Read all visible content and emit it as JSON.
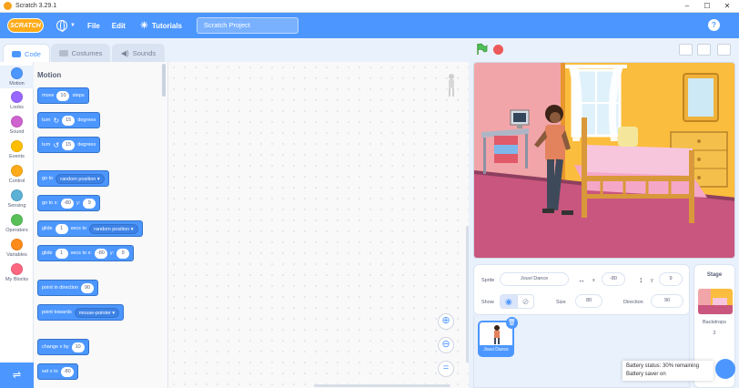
{
  "window": {
    "title": "Scratch 3.29.1",
    "controls": [
      "–",
      "☐",
      "✕"
    ]
  },
  "menubar": {
    "logo": "SCRATCH",
    "file": "File",
    "edit": "Edit",
    "tutorials": "Tutorials",
    "project_title": "Scratch Project"
  },
  "tabs": {
    "code": "Code",
    "costumes": "Costumes",
    "sounds": "Sounds"
  },
  "categories": [
    {
      "label": "Motion",
      "color": "#4c97ff"
    },
    {
      "label": "Looks",
      "color": "#9966ff"
    },
    {
      "label": "Sound",
      "color": "#cf63cf"
    },
    {
      "label": "Events",
      "color": "#ffbf00"
    },
    {
      "label": "Control",
      "color": "#ffab19"
    },
    {
      "label": "Sensing",
      "color": "#5cb1d6"
    },
    {
      "label": "Operators",
      "color": "#59c059"
    },
    {
      "label": "Variables",
      "color": "#ff8c1a"
    },
    {
      "label": "My Blocks",
      "color": "#ff6680"
    }
  ],
  "palette": {
    "section": "Motion",
    "move": {
      "a": "move",
      "n": "10",
      "b": "steps"
    },
    "turn_right": {
      "a": "turn",
      "n": "15",
      "b": "degrees"
    },
    "turn_left": {
      "a": "turn",
      "n": "15",
      "b": "degrees"
    },
    "goto": {
      "a": "go to",
      "dd": "random position"
    },
    "gotoxy": {
      "a": "go to x:",
      "x": "-80",
      "b": "y:",
      "y": "9"
    },
    "glide_to": {
      "a": "glide",
      "n": "1",
      "b": "secs to",
      "dd": "random position"
    },
    "glide_xy": {
      "a": "glide",
      "n": "1",
      "b": "secs to x:",
      "x": "-80",
      "c": "y:",
      "y": "9"
    },
    "point_dir": {
      "a": "point in direction",
      "n": "90"
    },
    "point_towards": {
      "a": "point towards",
      "dd": "mouse-pointer"
    },
    "change_x": {
      "a": "change x by",
      "n": "10"
    },
    "set_x": {
      "a": "set x to",
      "n": "-80"
    }
  },
  "sprite_info": {
    "sprite_label": "Sprite",
    "sprite_name": "Jouvi Dance",
    "x_label": "x",
    "x": "-80",
    "y_label": "y",
    "y": "9",
    "show_label": "Show",
    "size_label": "Size",
    "size": "80",
    "direction_label": "Direction",
    "direction": "90"
  },
  "sprite_tile": {
    "name": "Jouvi Dance"
  },
  "stage_pane": {
    "title": "Stage",
    "backdrops_label": "Backdrops",
    "backdrops_count": "2"
  },
  "toast": {
    "line1": "Battery status: 30% remaining",
    "line2": "Battery saver on"
  },
  "colors": {
    "accent": "#4c97ff",
    "green_flag": "#4cbf56",
    "stop": "#ec5959"
  }
}
